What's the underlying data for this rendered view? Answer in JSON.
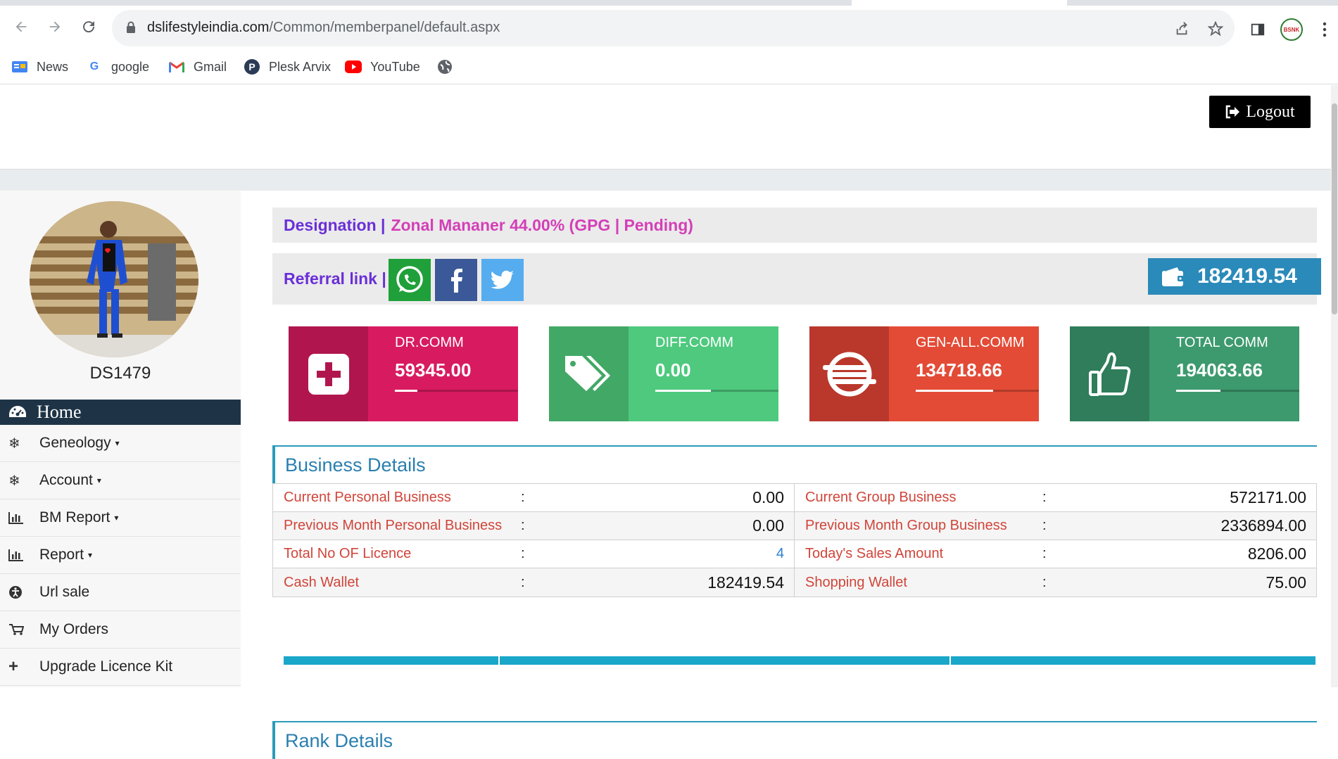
{
  "browser": {
    "url_domain": "dslifestyleindia.com",
    "url_path": "/Common/memberpanel/default.aspx",
    "profile_badge": "BSNK",
    "bookmarks": [
      {
        "label": "News",
        "icon": "google-news-icon"
      },
      {
        "label": "google",
        "icon": "google-icon"
      },
      {
        "label": "Gmail",
        "icon": "gmail-icon"
      },
      {
        "label": "Plesk Arvix",
        "icon": "plesk-icon"
      },
      {
        "label": "YouTube",
        "icon": "youtube-icon"
      },
      {
        "label": "",
        "icon": "globe-icon"
      }
    ]
  },
  "header": {
    "logout_label": "Logout"
  },
  "sidebar": {
    "username": "DS1479",
    "home_label": "Home",
    "items": [
      {
        "label": "Geneology",
        "icon": "snowflake-icon",
        "dropdown": true
      },
      {
        "label": "Account",
        "icon": "snowflake-icon",
        "dropdown": true
      },
      {
        "label": "BM Report",
        "icon": "bar-chart-icon",
        "dropdown": true
      },
      {
        "label": "Report",
        "icon": "bar-chart-icon",
        "dropdown": true
      },
      {
        "label": "Url sale",
        "icon": "accessibility-icon",
        "dropdown": false
      },
      {
        "label": "My Orders",
        "icon": "cart-icon",
        "dropdown": false
      },
      {
        "label": "Upgrade Licence Kit",
        "icon": "plus-icon",
        "dropdown": false
      }
    ]
  },
  "main": {
    "designation_label": "Designation |",
    "designation_value": "Zonal Mananer 44.00% (GPG | Pending)",
    "referral_label": "Referral link |",
    "wallet_amount": "182419.54",
    "stats": [
      {
        "label": "DR.COMM",
        "value": "59345.00",
        "color": "#d81b60",
        "dark": "#b0164d",
        "progress": 0.18,
        "icon": "plus-square-icon"
      },
      {
        "label": "DIFF.COMM",
        "value": "0.00",
        "color": "#4ec97e",
        "dark": "#42a866",
        "progress": 0.45,
        "icon": "tags-icon"
      },
      {
        "label": "GEN-ALL.COMM",
        "value": "134718.66",
        "color": "#e34b36",
        "dark": "#b9382b",
        "progress": 0.63,
        "icon": "stack-icon"
      },
      {
        "label": "TOTAL COMM",
        "value": "194063.66",
        "color": "#3d9a6e",
        "dark": "#2f7d5a",
        "progress": 0.36,
        "icon": "thumbs-up-icon"
      }
    ],
    "business": {
      "title": "Business Details",
      "rows": [
        {
          "left_key": "Current Personal Business",
          "left_val": "0.00",
          "right_key": "Current Group Business",
          "right_val": "572171.00"
        },
        {
          "left_key": "Previous Month Personal Business",
          "left_val": "0.00",
          "right_key": "Previous Month Group Business",
          "right_val": "2336894.00"
        },
        {
          "left_key": "Total No OF Licence",
          "left_val": "4",
          "right_key": "Today's Sales Amount",
          "right_val": "8206.00"
        },
        {
          "left_key": "Cash Wallet",
          "left_val": "182419.54",
          "right_key": "Shopping Wallet",
          "right_val": "75.00"
        }
      ]
    },
    "rank_title": "Rank Details"
  }
}
